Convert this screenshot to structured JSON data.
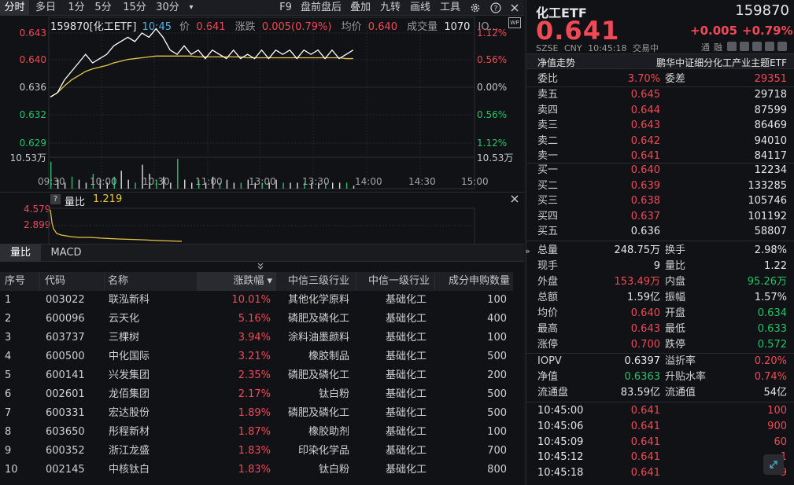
{
  "toolbar": {
    "tabs": [
      "分时",
      "多日",
      "1分",
      "5分",
      "15分",
      "30分"
    ],
    "more": "▾",
    "right": [
      "F9",
      "盘前盘后",
      "叠加",
      "九转",
      "画线",
      "工具"
    ]
  },
  "chart": {
    "code_label": "159870[化工ETF]",
    "time": "10:45",
    "price_label": "价",
    "price": "0.641",
    "change_label": "涨跌",
    "change": "0.005(0.79%)",
    "avg_label": "均价",
    "avg": "0.640",
    "vol_label": "成交量",
    "vol": "1070",
    "more": "IO...",
    "y_left": [
      "0.643",
      "0.640",
      "0.636",
      "0.632",
      "0.629",
      "10.53万"
    ],
    "y_right": [
      "1.12%",
      "0.56%",
      "0.00%",
      "0.56%",
      "1.12%",
      "10.53万"
    ],
    "x_ticks": [
      "09:30",
      "10:00",
      "10:30",
      "11:00",
      "13:00",
      "13:30",
      "14:00",
      "14:30",
      "15:00"
    ],
    "price_series": [
      0.6355,
      0.636,
      0.6375,
      0.6385,
      0.6395,
      0.6405,
      0.6395,
      0.64,
      0.6405,
      0.6415,
      0.642,
      0.6425,
      0.642,
      0.643,
      0.6425,
      0.6435,
      0.6425,
      0.641,
      0.6405,
      0.6415,
      0.6405,
      0.641,
      0.64,
      0.641,
      0.6405,
      0.64,
      0.641,
      0.64,
      0.6405,
      0.64,
      0.641,
      0.64,
      0.641,
      0.6405,
      0.641,
      0.64,
      0.641,
      0.6405,
      0.641,
      0.64,
      0.641,
      0.64,
      0.6405,
      0.641
    ],
    "avg_series": [
      0.6355,
      0.636,
      0.6368,
      0.6375,
      0.638,
      0.6385,
      0.6388,
      0.639,
      0.6392,
      0.6395,
      0.6397,
      0.6399,
      0.64,
      0.6401,
      0.6402,
      0.6403,
      0.6403,
      0.6403,
      0.6403,
      0.6403,
      0.6403,
      0.6402,
      0.6402,
      0.6402,
      0.6402,
      0.6402,
      0.6402,
      0.6402,
      0.6401,
      0.6401,
      0.6401,
      0.6401,
      0.6401,
      0.6401,
      0.6401,
      0.6401,
      0.6401,
      0.6401,
      0.6401,
      0.6401,
      0.6401,
      0.6401,
      0.64,
      0.64
    ],
    "volume_series": [
      9,
      3,
      2,
      4,
      3,
      2,
      5,
      3,
      2,
      4,
      6,
      3,
      2,
      8,
      5,
      3,
      4,
      2,
      10,
      3,
      2,
      3,
      2,
      4,
      2,
      3,
      2,
      2,
      3,
      2,
      2,
      2,
      3,
      2,
      2,
      2,
      2,
      2,
      2,
      2,
      2,
      2,
      2,
      1
    ]
  },
  "sub": {
    "help": "?",
    "name": "量比",
    "value": "1.219",
    "y": [
      "4.579",
      "2.899"
    ]
  },
  "subtabs": [
    "量比",
    "MACD"
  ],
  "table": {
    "headers": [
      "序号",
      "代码",
      "名称",
      "涨跌幅 ▾",
      "中信三级行业",
      "中信一级行业",
      "成分申购数量"
    ],
    "rows": [
      [
        "1",
        "003022",
        "联泓新科",
        "10.01%",
        "其他化学原料",
        "基础化工",
        "100"
      ],
      [
        "2",
        "600096",
        "云天化",
        "5.16%",
        "磷肥及磷化工",
        "基础化工",
        "400"
      ],
      [
        "3",
        "603737",
        "三棵树",
        "3.94%",
        "涂料油墨颜料",
        "基础化工",
        "100"
      ],
      [
        "4",
        "600500",
        "中化国际",
        "3.21%",
        "橡胶制品",
        "基础化工",
        "500"
      ],
      [
        "5",
        "600141",
        "兴发集团",
        "2.35%",
        "磷肥及磷化工",
        "基础化工",
        "200"
      ],
      [
        "6",
        "002601",
        "龙佰集团",
        "2.17%",
        "钛白粉",
        "基础化工",
        "500"
      ],
      [
        "7",
        "600331",
        "宏达股份",
        "1.89%",
        "磷肥及磷化工",
        "基础化工",
        "500"
      ],
      [
        "8",
        "603650",
        "彤程新材",
        "1.87%",
        "橡胶助剂",
        "基础化工",
        "100"
      ],
      [
        "9",
        "600352",
        "浙江龙盛",
        "1.83%",
        "印染化学品",
        "基础化工",
        "700"
      ],
      [
        "10",
        "002145",
        "中核钛白",
        "1.83%",
        "钛白粉",
        "基础化工",
        "800"
      ]
    ]
  },
  "quote": {
    "name": "化工ETF",
    "code": "159870",
    "price": "0.641",
    "change": "+0.005",
    "pct": "+0.79%",
    "exchange": "SZSE",
    "currency": "CNY",
    "time": "10:45:18",
    "status": "交易中",
    "tags": [
      "通",
      "融"
    ],
    "nav_label": "净值走势",
    "fund_name": "鹏华中证细分化工产业主题ETF"
  },
  "book": {
    "wb_label": "委比",
    "wb": "3.70%",
    "wc_label": "委差",
    "wc": "29351",
    "asks": [
      [
        "卖五",
        "0.645",
        "29718"
      ],
      [
        "卖四",
        "0.644",
        "87599"
      ],
      [
        "卖三",
        "0.643",
        "86469"
      ],
      [
        "卖二",
        "0.642",
        "94010"
      ],
      [
        "卖一",
        "0.641",
        "84117"
      ]
    ],
    "bids": [
      [
        "买一",
        "0.640",
        "12234"
      ],
      [
        "买二",
        "0.639",
        "133285"
      ],
      [
        "买三",
        "0.638",
        "105746"
      ],
      [
        "买四",
        "0.637",
        "101192"
      ],
      [
        "买五",
        "0.636",
        "58807"
      ]
    ]
  },
  "stats": [
    [
      "总量",
      "248.75万",
      "换手",
      "2.98%"
    ],
    [
      "现手",
      "9",
      "量比",
      "1.22"
    ],
    [
      "外盘",
      "153.49万",
      "内盘",
      "95.26万"
    ],
    [
      "总额",
      "1.59亿",
      "振幅",
      "1.57%"
    ],
    [
      "均价",
      "0.640",
      "开盘",
      "0.634"
    ],
    [
      "最高",
      "0.643",
      "最低",
      "0.633"
    ],
    [
      "涨停",
      "0.700",
      "跌停",
      "0.572"
    ]
  ],
  "iopv": [
    [
      "IOPV",
      "0.6397",
      "溢折率",
      "0.20%"
    ],
    [
      "净值",
      "0.6363",
      "升贴水率",
      "0.74%"
    ],
    [
      "流通盘",
      "83.59亿",
      "流通值",
      "54亿"
    ]
  ],
  "ticks": [
    [
      "10:45:00",
      "0.641",
      "100"
    ],
    [
      "10:45:06",
      "0.641",
      "900"
    ],
    [
      "10:45:09",
      "0.641",
      "60"
    ],
    [
      "10:45:12",
      "0.641",
      "1"
    ],
    [
      "10:45:18",
      "0.641",
      "9"
    ]
  ],
  "colors": {
    "up": "#f24957",
    "down": "#25c46a",
    "avg": "#e8c547",
    "price": "#ffffff"
  }
}
